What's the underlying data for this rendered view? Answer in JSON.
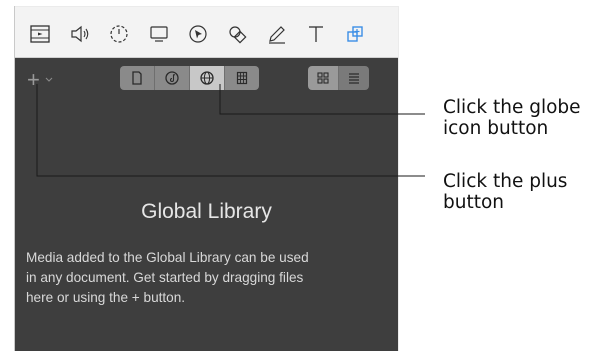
{
  "toolbar": {
    "icons": [
      "film-icon",
      "speaker-icon",
      "timer-icon",
      "monitor-icon",
      "cursor-icon",
      "shapes-icon",
      "pencil-icon",
      "text-icon",
      "library-icon"
    ],
    "active_color": "#3a8ee6"
  },
  "library": {
    "add_symbol": "+",
    "view_tabs": [
      "document-icon",
      "music-icon",
      "globe-icon",
      "grid-icon"
    ],
    "active_tab": "globe-icon",
    "layout_modes": [
      "grid-view-icon",
      "list-view-icon"
    ],
    "active_layout": "grid-view-icon",
    "title": "Global Library",
    "description_lines": [
      "Media added to the Global Library can be used",
      "in any document.  Get started by dragging files",
      "here or using the + button."
    ]
  },
  "callouts": {
    "globe": [
      "Click the globe",
      "icon button"
    ],
    "plus": [
      "Click the plus",
      "button"
    ]
  }
}
